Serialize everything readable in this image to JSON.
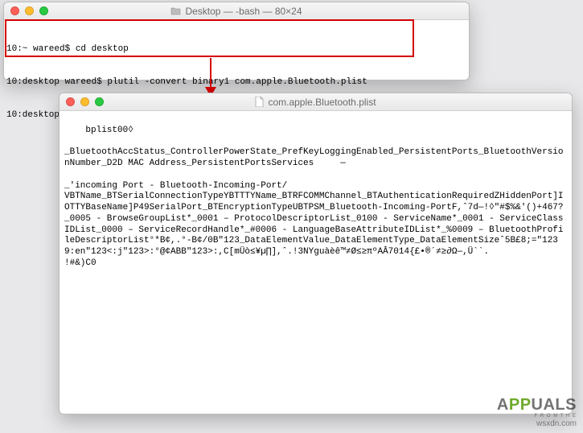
{
  "terminal": {
    "title": "Desktop — -bash — 80×24",
    "lines": [
      "10:~ wareed$ cd desktop",
      "10:desktop wareed$ plutil -convert binary1 com.apple.Bluetooth.plist",
      "10:desktop wareed$ "
    ]
  },
  "editor": {
    "title": "com.apple.Bluetooth.plist",
    "content": "bplist00◊\n\n_BluetoothAccStatus_ControllerPowerState_PrefKeyLoggingEnabled_PersistentPorts_BluetoothVersionNumber_D2D MAC Address_PersistentPortsServices     —\n\n_'incoming Port - Bluetooth-Incoming-Port/\nVBTName_BTSerialConnectionTypeYBTTTYName_BTRFCOMMChannel_BTAuthenticationRequiredZHiddenPort]IOTTYBaseName]P49SerialPort_BTEncryptionTypeUBTPSM_Bluetooth-Incoming-PortF,ˆ7d—!◊\"#$%&'()+467?_0005 - BrowseGroupList*_0001 – ProtocolDescriptorList_0100 - ServiceName*_0001 - ServiceClassIDList_0000 – ServiceRecordHandle*_#0006 - LanguageBaseAttributeIDList*_%0009 – BluetoothProfileDescriptorList°*B¢,.°-B¢/0B\"123_DataElementValue_DataElementType_DataElementSizeˆ5B£8;=\"1239:en\"123<:j\"123>:°@¢ABB\"123>:,C[mÜò≤¥µ∏],ˆ.!3NYguàèê™≠Ø≤≥πºAÂ7014{£•®´≠≥∂Ω—,Ü``.\n!#&)C0"
  },
  "watermark": {
    "brand_pre": "A",
    "brand_mid": "PP",
    "brand_post": "UALS",
    "sub": "F R O M   T H E",
    "site": "wsxdn.com"
  },
  "highlight": {
    "color": "#d40000"
  }
}
